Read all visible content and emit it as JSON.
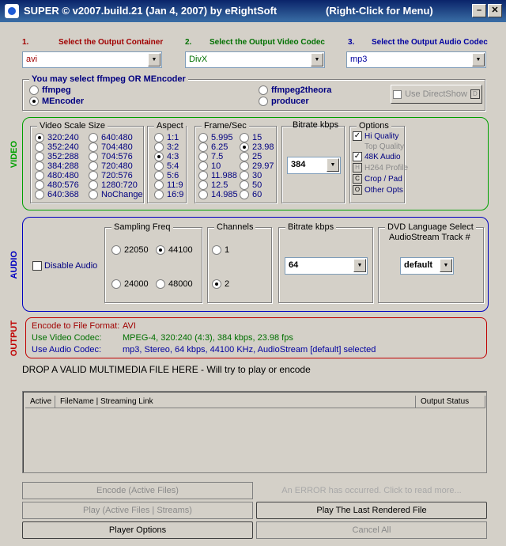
{
  "window": {
    "title": "SUPER © v2007.build.21 (Jan 4, 2007) by eRightSoft",
    "hint": "(Right-Click for Menu)"
  },
  "steps": {
    "s1": {
      "num": "1.",
      "label": "Select the Output Container",
      "value": "avi"
    },
    "s2": {
      "num": "2.",
      "label": "Select the Output Video Codec",
      "value": "DivX"
    },
    "s3": {
      "num": "3.",
      "label": "Select the Output Audio Codec",
      "value": "mp3"
    }
  },
  "encoder": {
    "title": "You may select ffmpeg OR MEncoder",
    "options": [
      "ffmpeg",
      "MEncoder",
      "ffmpeg2theora",
      "producer"
    ],
    "selected": "MEncoder",
    "directshow_label": "Use DirectShow",
    "directshow_key": "D"
  },
  "video": {
    "section_label": "VIDEO",
    "scale": {
      "title": "Video Scale Size",
      "col1": [
        "320:240",
        "352:240",
        "352:288",
        "384:288",
        "480:480",
        "480:576",
        "640:368"
      ],
      "col2": [
        "640:480",
        "704:480",
        "704:576",
        "720:480",
        "720:576",
        "1280:720",
        "NoChange"
      ],
      "selected": "320:240"
    },
    "aspect": {
      "title": "Aspect",
      "options": [
        "1:1",
        "3:2",
        "4:3",
        "5:4",
        "5:6",
        "11:9",
        "16:9"
      ],
      "selected": "4:3"
    },
    "fps": {
      "title": "Frame/Sec",
      "col1": [
        "5.995",
        "6.25",
        "7.5",
        "10",
        "11.988",
        "12.5",
        "14.985"
      ],
      "col2": [
        "15",
        "23.98",
        "25",
        "29.97",
        "30",
        "50",
        "60"
      ],
      "selected": "23.98"
    },
    "bitrate": {
      "title": "Bitrate  kbps",
      "value": "384"
    },
    "options": {
      "title": "Options",
      "hi_quality": "Hi Quality",
      "top_quality": "Top Quality",
      "audio_48k": "48K Audio",
      "h264": "H264 Profile",
      "h264_key": "H",
      "crop": "Crop / Pad",
      "crop_key": "C",
      "other": "Other Opts",
      "other_key": "O"
    }
  },
  "audio": {
    "section_label": "AUDIO",
    "disable": "Disable Audio",
    "sampling": {
      "title": "Sampling Freq",
      "options": [
        "22050",
        "44100",
        "24000",
        "48000"
      ],
      "selected": "44100"
    },
    "channels": {
      "title": "Channels",
      "options": [
        "1",
        "2"
      ],
      "selected": "2"
    },
    "bitrate": {
      "title": "Bitrate  kbps",
      "value": "64"
    },
    "dvd": {
      "title1": "DVD Language Select",
      "title2": "AudioStream  Track #",
      "value": "default"
    }
  },
  "output": {
    "section_label": "OUTPUT",
    "format_label": "Encode to File Format:",
    "format_value": "AVI",
    "video_label": "Use Video Codec:",
    "video_value": "MPEG-4,  320:240 (4:3),  384 kbps,  23.98 fps",
    "audio_label": "Use Audio Codec:",
    "audio_value": "mp3,  Stereo,  64 kbps,  44100 KHz,  AudioStream [default] selected"
  },
  "drop_text": "DROP A VALID MULTIMEDIA FILE HERE - Will try to play or encode",
  "list": {
    "columns": [
      "Active",
      "FileName  |  Streaming Link",
      "Output Status"
    ]
  },
  "buttons": {
    "encode": "Encode (Active Files)",
    "error": "An ERROR has occurred. Click to read more...",
    "play_active": "Play (Active Files | Streams)",
    "play_last": "Play The Last Rendered File",
    "player_options": "Player Options",
    "cancel_all": "Cancel All"
  },
  "colors": {
    "step1": "#a00000",
    "step2": "#007000",
    "step3": "#0000a0",
    "video_border": "#00a000",
    "audio_border": "#0000c0",
    "output_border": "#c00000"
  }
}
